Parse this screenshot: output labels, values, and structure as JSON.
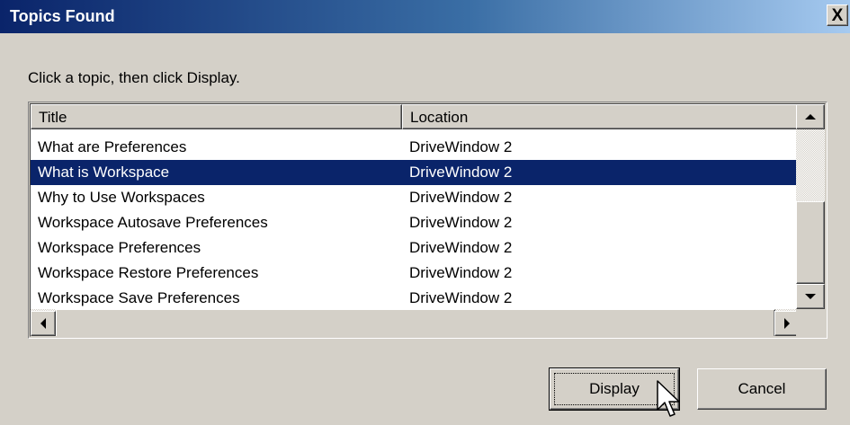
{
  "window": {
    "title": "Topics Found",
    "close_label": "X"
  },
  "instruction": "Click a topic, then click Display.",
  "list": {
    "columns": [
      "Title",
      "Location"
    ],
    "rows": [
      {
        "title": "What are Preferences",
        "location": "DriveWindow 2",
        "selected": false
      },
      {
        "title": "What is Workspace",
        "location": "DriveWindow 2",
        "selected": true
      },
      {
        "title": "Why to Use Workspaces",
        "location": "DriveWindow 2",
        "selected": false
      },
      {
        "title": "Workspace Autosave Preferences",
        "location": "DriveWindow 2",
        "selected": false
      },
      {
        "title": "Workspace Preferences",
        "location": "DriveWindow 2",
        "selected": false
      },
      {
        "title": "Workspace Restore Preferences",
        "location": "DriveWindow 2",
        "selected": false
      },
      {
        "title": "Workspace Save Preferences",
        "location": "DriveWindow 2",
        "selected": false
      }
    ]
  },
  "buttons": {
    "display": "Display",
    "cancel": "Cancel"
  },
  "colors": {
    "selection": "#0a246a",
    "face": "#d4d0c8"
  }
}
